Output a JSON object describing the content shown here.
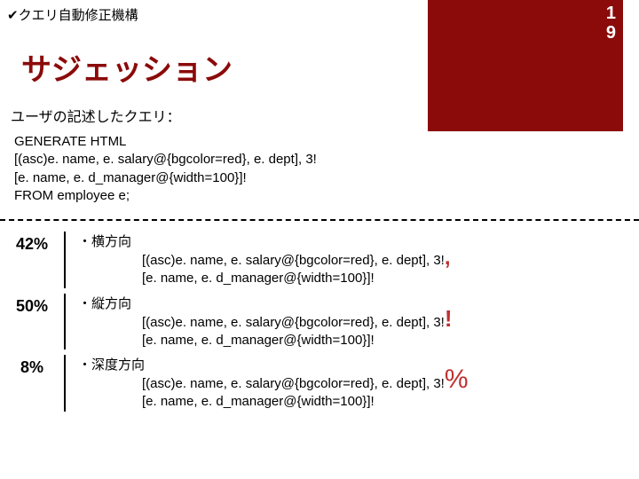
{
  "header": {
    "check_label": "✔クエリ自動修正機構",
    "slide_number_line1": "1",
    "slide_number_line2": "9"
  },
  "title": "サジェッション",
  "subtitle": "ユーザの記述したクエリ：",
  "query": {
    "l1": "GENERATE HTML",
    "l2": "[(asc)e. name, e. salary@{bgcolor=red}, e. dept], 3!",
    "l3": "[e. name, e. d_manager@{width=100}]!",
    "l4": "FROM employee e;"
  },
  "rows": [
    {
      "pct": "42%",
      "label": "・横方向",
      "body1": "[(asc)e. name, e. salary@{bgcolor=red}, e. dept], 3!",
      "accent1": ",",
      "body2": "[e. name, e. d_manager@{width=100}]!"
    },
    {
      "pct": "50%",
      "label": "・縦方向",
      "body1": "[(asc)e. name, e. salary@{bgcolor=red}, e. dept], 3!",
      "accent1": "!",
      "body2": "[e. name, e. d_manager@{width=100}]!"
    },
    {
      "pct": "8%",
      "label": "・深度方向",
      "body1": "[(asc)e. name, e. salary@{bgcolor=red}, e. dept], 3!",
      "accent1": "%",
      "body2": "[e. name, e. d_manager@{width=100}]!"
    }
  ]
}
